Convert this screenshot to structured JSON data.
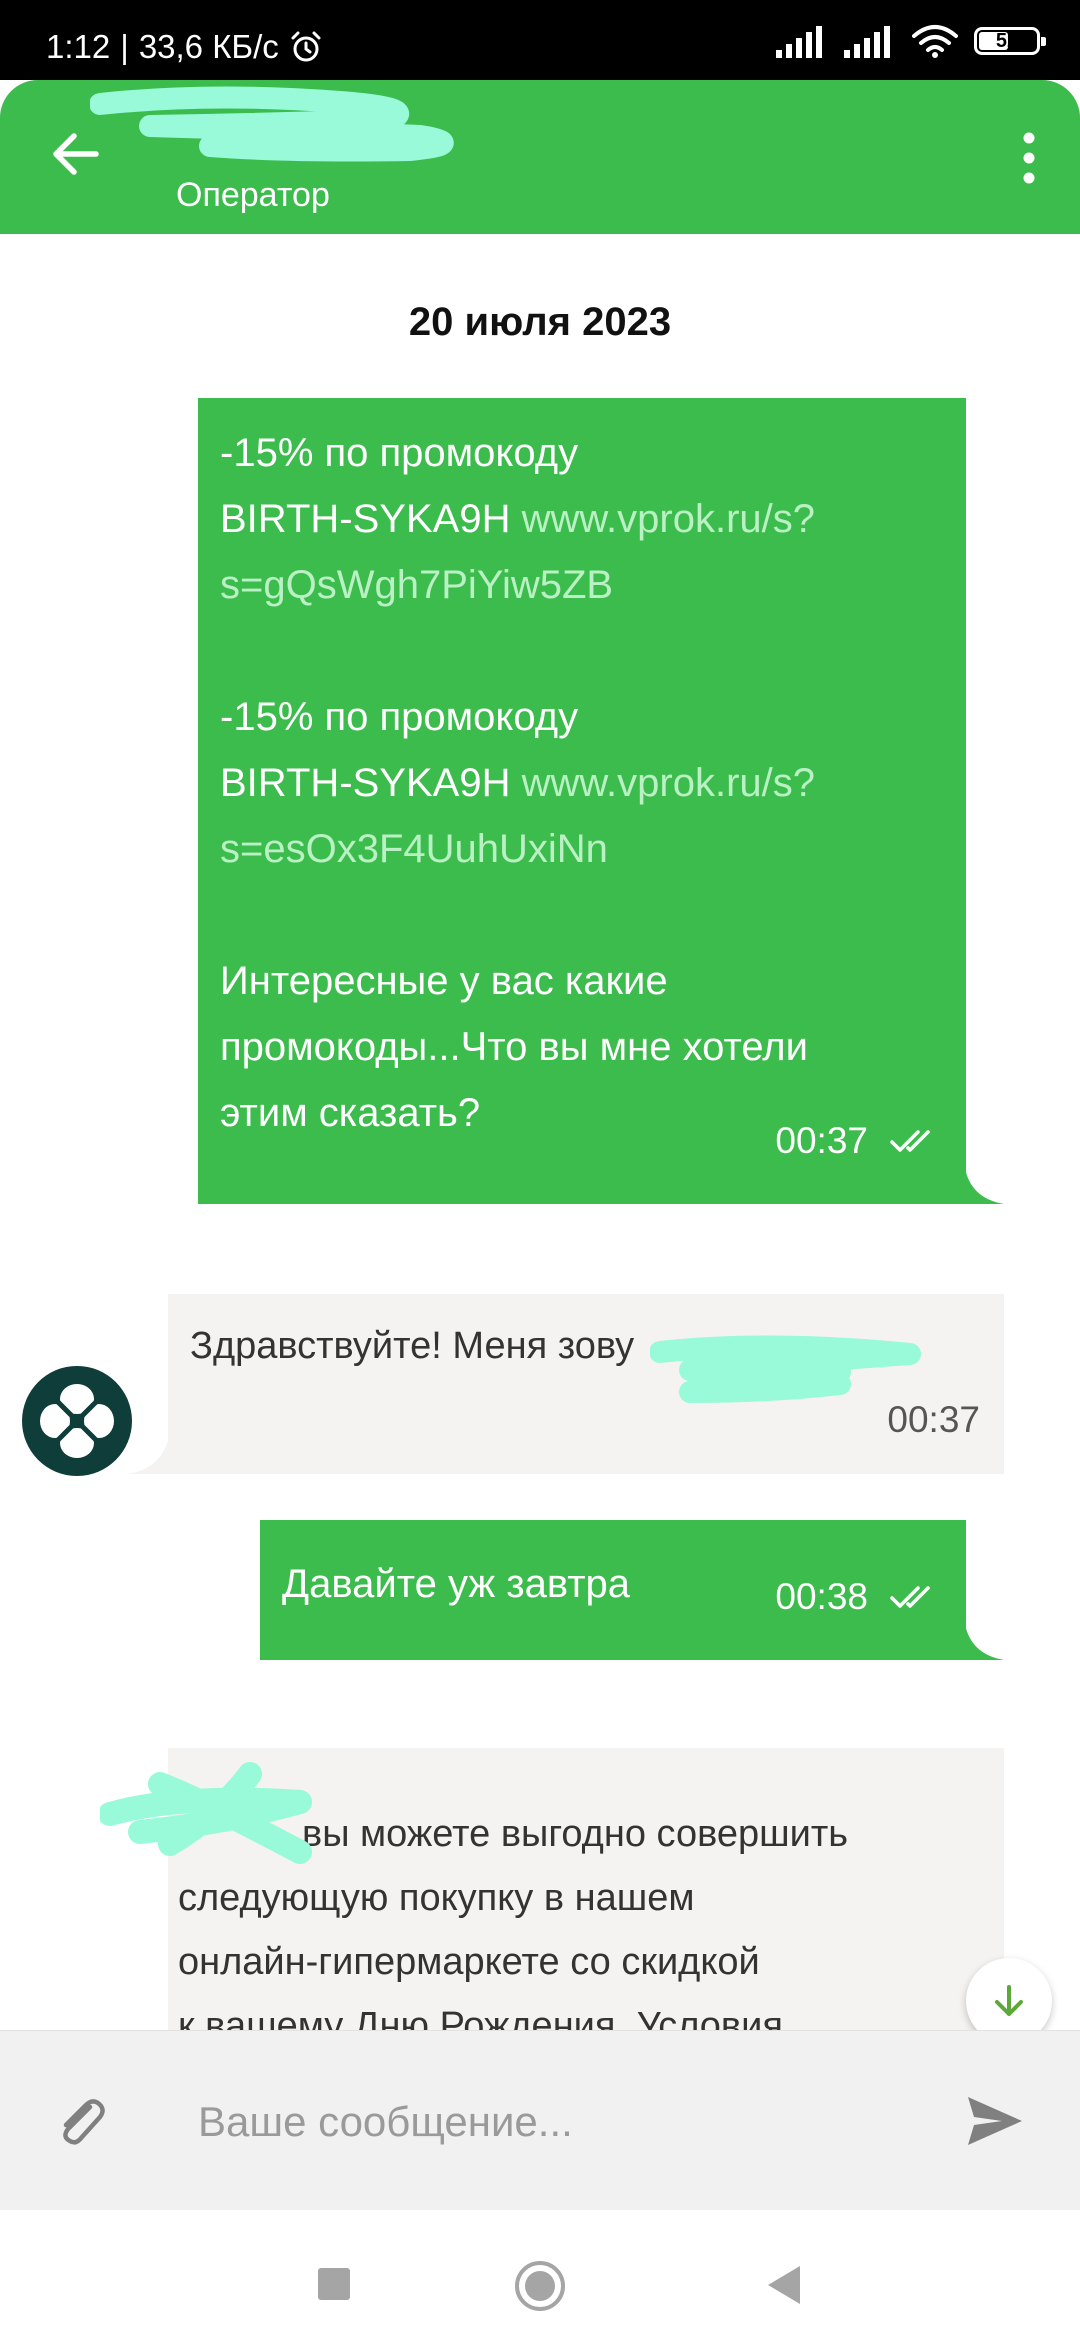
{
  "status_bar": {
    "time": "1:12",
    "speed": "33,6 КБ/с",
    "battery": "52",
    "battery_percent": 52
  },
  "header": {
    "subtitle": "Оператор",
    "accent_color": "#3cbc4c",
    "back_icon": "arrow-left-icon",
    "menu_icon": "more-vertical-icon"
  },
  "chat": {
    "date": "20 июля 2023",
    "messages": [
      {
        "direction": "outgoing",
        "paragraphs": [
          {
            "line1": "-15% по промокоду",
            "code": "BIRTH-SYKA9H",
            "link_a": "www.vprok.ru/s?",
            "link_b": "s=gQsWgh7PiYiw5ZB"
          },
          {
            "line1": "-15% по промокоду",
            "code": "BIRTH-SYKA9H",
            "link_a": "www.vprok.ru/s?",
            "link_b": "s=esOx3F4UuhUxiNn"
          }
        ],
        "closing_lines": [
          "Интересные у вас какие",
          "промокоды...Что вы мне хотели",
          "этим сказать?"
        ],
        "time": "00:37",
        "status_icon": "double-check-icon"
      },
      {
        "direction": "incoming",
        "text": "Здравствуйте! Меня зову",
        "time": "00:37"
      },
      {
        "direction": "outgoing",
        "text": "Давайте уж завтра",
        "time": "00:38",
        "status_icon": "double-check-icon"
      },
      {
        "direction": "incoming",
        "lines": [
          "вы можете выгодно совершить",
          "следующую покупку в нашем",
          "онлайн-гипермаркете со скидкой",
          "к вашему Дню Рождения. Условия"
        ]
      }
    ]
  },
  "input": {
    "placeholder": "Ваше сообщение...",
    "attach_icon": "paperclip-icon",
    "send_icon": "send-icon"
  }
}
